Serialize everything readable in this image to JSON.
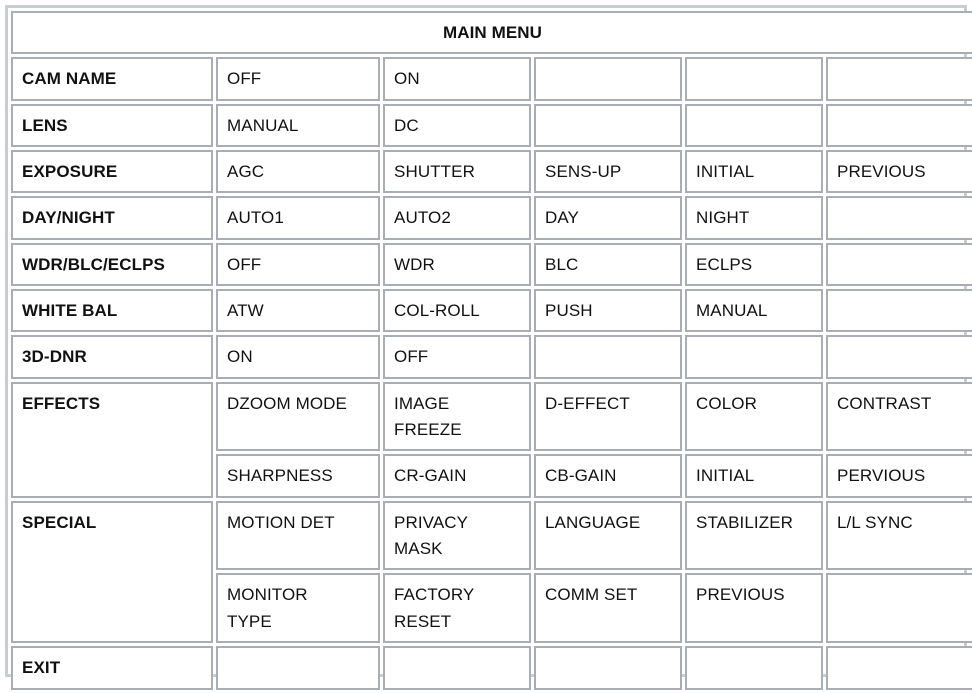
{
  "menu": {
    "title": "MAIN MENU",
    "columns": 6,
    "rows": [
      {
        "id": "title-row",
        "type": "title",
        "label": "MAIN MENU"
      },
      {
        "id": "cam-name",
        "type": "option",
        "label": "CAM NAME",
        "options": [
          "OFF",
          "ON",
          "",
          "",
          ""
        ]
      },
      {
        "id": "lens",
        "type": "option",
        "label": "LENS",
        "options": [
          "MANUAL",
          "DC",
          "",
          "",
          ""
        ]
      },
      {
        "id": "exposure",
        "type": "option",
        "label": "EXPOSURE",
        "options": [
          "AGC",
          "SHUTTER",
          "SENS-UP",
          "INITIAL",
          "PREVIOUS"
        ]
      },
      {
        "id": "day-night",
        "type": "option",
        "label": "DAY/NIGHT",
        "options": [
          "AUTO1",
          "AUTO2",
          "DAY",
          "NIGHT",
          ""
        ]
      },
      {
        "id": "wdr-blc-eclps",
        "type": "option",
        "label": "WDR/BLC/ECLPS",
        "options": [
          "OFF",
          "WDR",
          "BLC",
          "ECLPS",
          ""
        ]
      },
      {
        "id": "white-bal",
        "type": "option",
        "label": "WHITE BAL",
        "options": [
          "ATW",
          "COL-ROLL",
          "PUSH",
          "MANUAL",
          ""
        ]
      },
      {
        "id": "3d-dnr",
        "type": "option",
        "label": "3D-DNR",
        "options": [
          "ON",
          "OFF",
          "",
          "",
          ""
        ]
      },
      {
        "id": "effects-1",
        "type": "option-span",
        "label": "EFFECTS",
        "options": [
          "DZOOM MODE",
          "IMAGE\nFREEZE",
          "D-EFFECT",
          "COLOR",
          "CONTRAST"
        ]
      },
      {
        "id": "effects-2",
        "type": "option-continued",
        "label": "",
        "options": [
          "SHARPNESS",
          "CR-GAIN",
          "CB-GAIN",
          "INITIAL",
          "PERVIOUS"
        ]
      },
      {
        "id": "special-1",
        "type": "option-span",
        "label": "SPECIAL",
        "options": [
          "MOTION DET",
          "PRIVACY\nMASK",
          "LANGUAGE",
          "STABILIZER",
          "L/L SYNC"
        ]
      },
      {
        "id": "special-2",
        "type": "option-continued",
        "label": "",
        "options": [
          "MONITOR\nTYPE",
          "FACTORY\nRESET",
          "COMM SET",
          "PREVIOUS",
          ""
        ]
      },
      {
        "id": "exit",
        "type": "option",
        "label": "EXIT",
        "options": [
          "",
          "",
          "",
          "",
          ""
        ]
      }
    ]
  },
  "colors": {
    "border": "#a9adb4",
    "outer_border": "#c9ccd1",
    "text": "#111111",
    "background": "#ffffff"
  }
}
